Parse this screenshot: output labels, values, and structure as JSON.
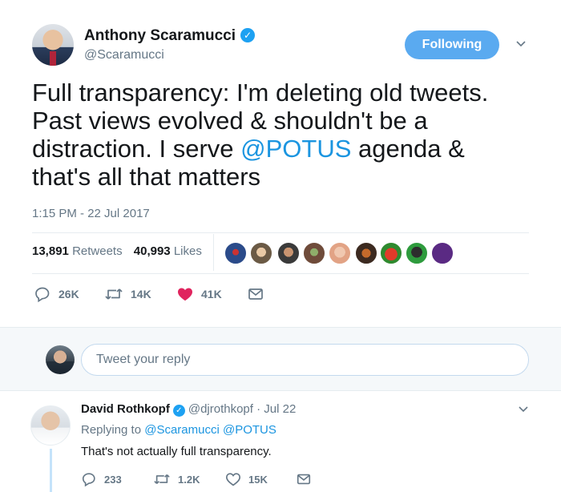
{
  "tweet": {
    "author_name": "Anthony Scaramucci",
    "author_handle": "@Scaramucci",
    "follow_label": "Following",
    "text_part1": "Full transparency: I'm deleting old tweets. Past views evolved & shouldn't be a distraction. I serve ",
    "text_mention": "@POTUS",
    "text_part2": " agenda & that's all that matters",
    "timestamp": "1:15 PM - 22 Jul 2017",
    "retweets_count": "13,891",
    "retweets_label": "Retweets",
    "likes_count": "40,993",
    "likes_label": "Likes",
    "actions": {
      "reply_count": "26K",
      "retweet_count": "14K",
      "like_count": "41K"
    },
    "colors": {
      "accent": "#1da1f2",
      "mention": "#1b95e0",
      "like": "#e0245e",
      "follow_button": "#5aaaf0"
    }
  },
  "reply_composer": {
    "placeholder": "Tweet your reply"
  },
  "reply": {
    "author_name": "David Rothkopf",
    "author_handle": "@djrothkopf",
    "date": "· Jul 22",
    "replying_prefix": "Replying to",
    "replying_to": "@Scaramucci @POTUS",
    "text": "That's not actually full transparency.",
    "reply_count": "233",
    "retweet_count": "1.2K",
    "like_count": "15K"
  }
}
